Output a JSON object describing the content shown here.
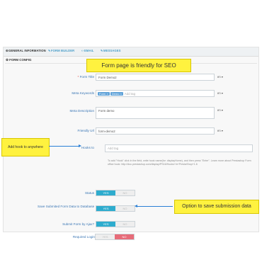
{
  "tabs": [
    {
      "label": "GENERAL INFORMATION",
      "icon": "gear-icon"
    },
    {
      "label": "FORM BUILDER",
      "icon": "wrench-icon"
    },
    {
      "label": "EMAIL",
      "icon": "code-icon"
    },
    {
      "label": "MESSAGES",
      "icon": "wrench-icon"
    }
  ],
  "section_title": "FORM CONFIG",
  "fields": {
    "form_title": {
      "label": "Form Title",
      "value": "Form Demo2",
      "lang": "en ▾"
    },
    "meta_keywords": {
      "label": "Meta Keywords",
      "tags": [
        "Form",
        "Demo"
      ],
      "placeholder": "Add tag",
      "lang": "en ▾"
    },
    "meta_description": {
      "label": "Meta Description",
      "value": "Form demo",
      "lang": "en ▾"
    },
    "friendly_url": {
      "label": "Friendly Url",
      "value": "form-demo2",
      "lang": "en ▾"
    },
    "hooks_to": {
      "label": "Hooks to",
      "placeholder": "Add tag"
    }
  },
  "help_text": "To add \"Hook\" click in the field, write hook name(for: displayHome), and then press \"Enter\". Learn more about Prestashop Form office hook: http://doc.prestashop.com/display/PS16/Hooks+in+PrestaShop+1.6",
  "toggles": [
    {
      "label": "Status",
      "yes": "YES",
      "no": "NO",
      "selected": "yes"
    },
    {
      "label": "Save Submited Form Data to Database",
      "yes": "YES",
      "no": "NO",
      "selected": "yes"
    },
    {
      "label": "Submit Form by Ajax?",
      "yes": "YES",
      "no": "NO",
      "selected": "yes"
    },
    {
      "label": "Required Login",
      "yes": "YES",
      "no": "NO",
      "selected": "no"
    }
  ],
  "callouts": {
    "seo": "Form page is friendly for SEO",
    "hook": "Add hook to anywhere",
    "save": "Option to save submission data"
  },
  "colors": {
    "accent": "#2eacce",
    "no_active": "#e76c79",
    "callout": "#fff23f",
    "arrow": "#2a7fd6",
    "label": "#3a76b4"
  }
}
